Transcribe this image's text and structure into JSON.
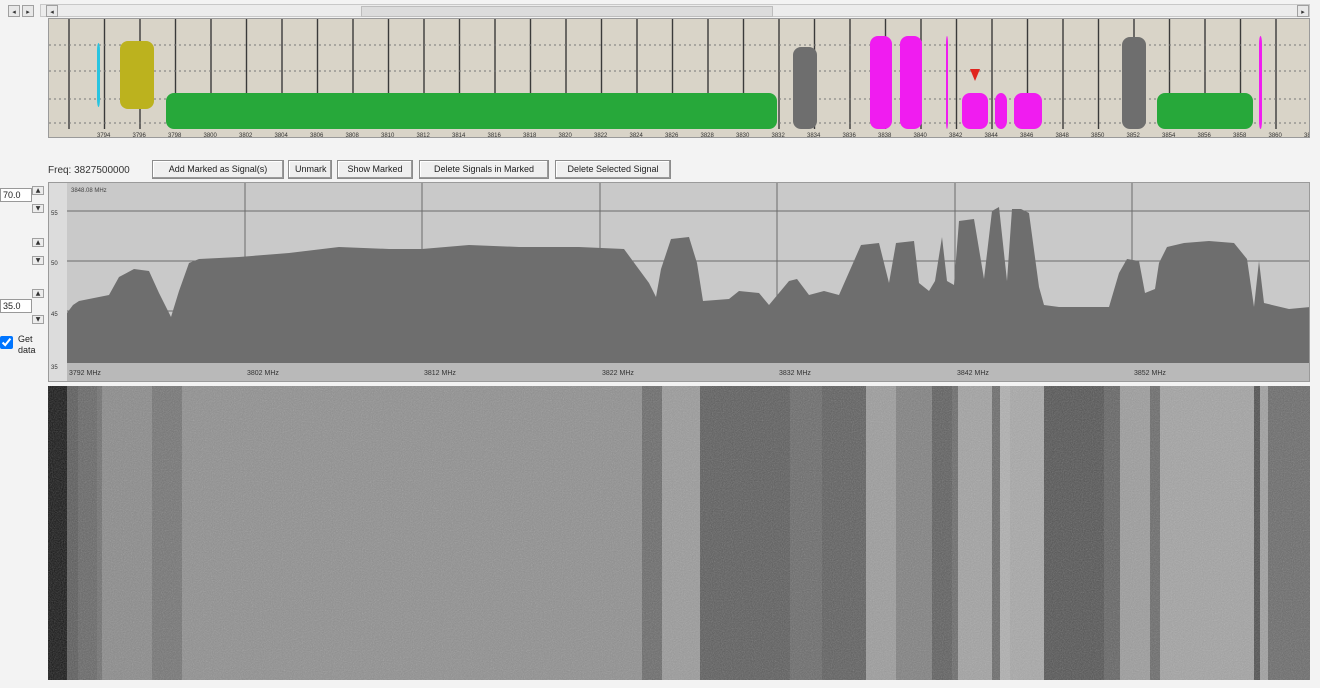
{
  "top_scroll": {
    "left_arrow": "◂",
    "right_arrow": "▸",
    "start_arrow": "◂",
    "end_arrow": "▸"
  },
  "signal_map": {
    "tick_labels": [
      "3794",
      "3796",
      "3798",
      "3800",
      "3802",
      "3804",
      "3806",
      "3808",
      "3810",
      "3812",
      "3814",
      "3816",
      "3818",
      "3820",
      "3822",
      "3824",
      "3826",
      "3828",
      "3830",
      "3832",
      "3834",
      "3836",
      "3838",
      "3840",
      "3842",
      "3844",
      "3846",
      "3848",
      "3850",
      "3852",
      "3854",
      "3856",
      "3858",
      "3860",
      "38"
    ],
    "colors": {
      "cyan": "#29c4e0",
      "olive": "#bcb21e",
      "green": "#27a83a",
      "gray": "#6e6e6e",
      "magenta": "#f01cf0",
      "marker": "#e0241e"
    }
  },
  "toolbar": {
    "freq_label": "Freq: 3827500000",
    "buttons": [
      "Add Marked as Signal(s)",
      "Unmark",
      "Show Marked",
      "Delete Signals in Marked",
      "Delete Selected Signal"
    ]
  },
  "left_controls": {
    "top_value": "70.0",
    "bottom_value": "35.0",
    "up": "▲",
    "down": "▼",
    "get_data_label": "Get data",
    "get_data_checked": true
  },
  "spectrum": {
    "header": "3848.08 MHz",
    "y_ticks": [
      "55",
      "50",
      "45",
      "35"
    ],
    "x_labels": [
      "3792 MHz",
      "3802 MHz",
      "3812 MHz",
      "3822 MHz",
      "3832 MHz",
      "3842 MHz",
      "3852 MHz"
    ]
  }
}
